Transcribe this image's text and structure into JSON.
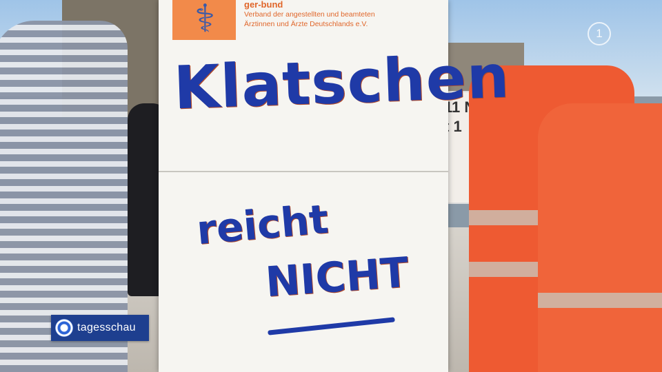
{
  "sign": {
    "association_top": "ger-bund",
    "association_line1": "Verband der angestellten und beamteten",
    "association_line2": "Ärztinnen und Ärzte Deutschlands e.V.",
    "line1": "Klatschen",
    "line2": "reicht",
    "line3": "NICHT"
  },
  "background_sign": {
    "text": "11 N\nt 1"
  },
  "channel": {
    "name": "tagesschau",
    "corner_mark": "1"
  },
  "colors": {
    "vest": "#ee5a32",
    "ink": "#1f3aa7",
    "logo": "#f28a4a",
    "banner": "#1e3f8f"
  }
}
